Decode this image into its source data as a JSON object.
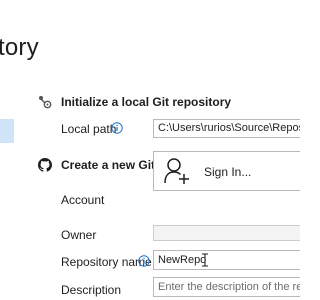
{
  "window": {
    "title": "tory"
  },
  "local_git": {
    "heading": "Initialize a local Git repository",
    "local_path_label": "Local path",
    "local_path_value": "C:\\Users\\rurios\\Source\\Repos\\New"
  },
  "github": {
    "heading": "Create a new GitHub repository",
    "account_label": "Account",
    "sign_in_label": "Sign In...",
    "owner_label": "Owner",
    "owner_value": "",
    "repo_name_label": "Repository name",
    "repo_name_value": "NewRepo",
    "description_label": "Description",
    "description_placeholder": "Enter the description of the repos"
  },
  "colors": {
    "accent": "#0078d4",
    "selection": "#cfe4f8",
    "info_icon": "#1a73c8"
  }
}
